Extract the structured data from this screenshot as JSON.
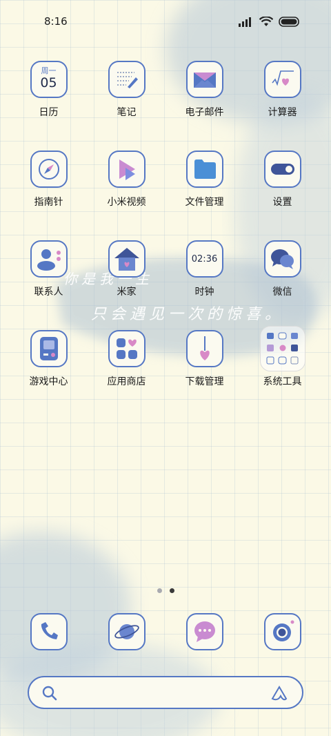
{
  "status_bar": {
    "time": "8:16",
    "signal_icon": "signal-icon",
    "wifi_icon": "wifi-icon",
    "battery_icon": "battery-icon"
  },
  "theme": {
    "accent": "#5577c4",
    "pink": "#d889c7",
    "background": "#fbf9e6"
  },
  "calendar_widget": {
    "weekday": "周一",
    "day": "05"
  },
  "clock_icon_time": "02:36",
  "apps": [
    {
      "label": "日历",
      "icon": "calendar-icon"
    },
    {
      "label": "笔记",
      "icon": "notes-icon"
    },
    {
      "label": "电子邮件",
      "icon": "mail-icon"
    },
    {
      "label": "计算器",
      "icon": "calculator-icon"
    },
    {
      "label": "指南针",
      "icon": "compass-icon"
    },
    {
      "label": "小米视频",
      "icon": "video-icon"
    },
    {
      "label": "文件管理",
      "icon": "folder-icon"
    },
    {
      "label": "设置",
      "icon": "settings-toggle-icon"
    },
    {
      "label": "联系人",
      "icon": "contacts-icon"
    },
    {
      "label": "米家",
      "icon": "home-icon"
    },
    {
      "label": "时钟",
      "icon": "clock-icon"
    },
    {
      "label": "微信",
      "icon": "wechat-icon"
    },
    {
      "label": "游戏中心",
      "icon": "game-icon"
    },
    {
      "label": "应用商店",
      "icon": "app-store-icon"
    },
    {
      "label": "下载管理",
      "icon": "download-icon"
    },
    {
      "label": "系统工具",
      "icon": "folder-system-tools-icon"
    }
  ],
  "wallpaper_text": {
    "line1": "你是我一生",
    "line2": "只会遇见一次的惊喜。"
  },
  "page_indicator": {
    "count": 2,
    "active": 2
  },
  "dock": [
    {
      "name": "phone",
      "icon": "phone-icon"
    },
    {
      "name": "browser",
      "icon": "planet-icon"
    },
    {
      "name": "messages",
      "icon": "message-icon"
    },
    {
      "name": "camera",
      "icon": "camera-icon"
    }
  ],
  "search_bar": {
    "search_icon": "search-icon",
    "assistant_icon": "assistant-icon"
  }
}
